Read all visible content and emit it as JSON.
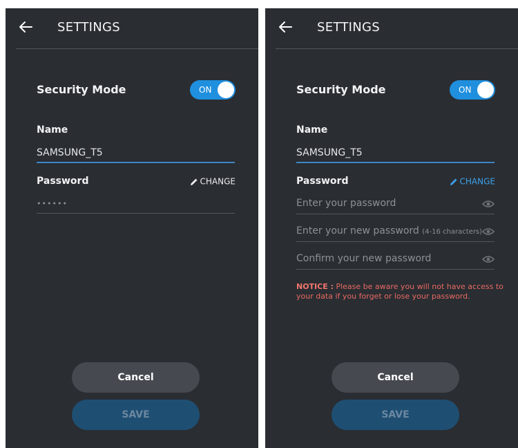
{
  "screens": [
    {
      "header": {
        "title": "SETTINGS"
      },
      "security_mode": {
        "label": "Security Mode",
        "toggle": "ON"
      },
      "name": {
        "label": "Name",
        "value": "SAMSUNG_T5"
      },
      "password": {
        "label": "Password",
        "change": "CHANGE",
        "masked": "••••••"
      },
      "buttons": {
        "cancel": "Cancel",
        "save": "SAVE"
      }
    },
    {
      "header": {
        "title": "SETTINGS"
      },
      "security_mode": {
        "label": "Security Mode",
        "toggle": "ON"
      },
      "name": {
        "label": "Name",
        "value": "SAMSUNG_T5"
      },
      "password": {
        "label": "Password",
        "change": "CHANGE",
        "current_placeholder": "Enter your password",
        "new_placeholder": "Enter your new password",
        "new_hint": "(4-16 characters)",
        "confirm_placeholder": "Confirm your new password"
      },
      "notice": {
        "label": "NOTICE :",
        "text": "Please be aware you will not have access to your data if you forget or lose your password."
      },
      "buttons": {
        "cancel": "Cancel",
        "save": "SAVE"
      }
    }
  ],
  "icons": {
    "back": "arrow-left-icon",
    "change": "pencil-icon",
    "visibility": "eye-icon"
  },
  "colors": {
    "background": "#2a2d32",
    "accent": "#1f8fde",
    "notice": "#e86a62",
    "save_disabled": "#1e4f73"
  }
}
